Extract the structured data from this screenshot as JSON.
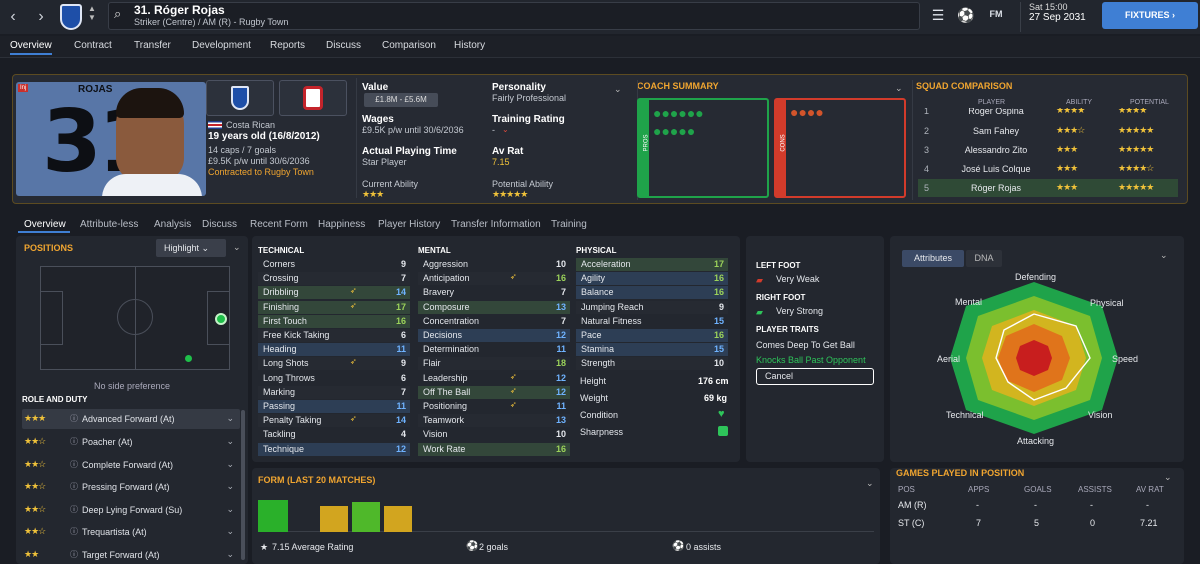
{
  "header": {
    "title": "31. Róger Rojas",
    "subtitle": "Striker (Centre) / AM (R) - Rugby Town",
    "date_day": "Sat 15:00",
    "date": "27 Sep 2031",
    "fixtures": "FIXTURES",
    "fm": "FM"
  },
  "menu": [
    "Overview",
    "Contract",
    "Transfer",
    "Development",
    "Reports",
    "Discuss",
    "Comparison",
    "History"
  ],
  "profile": {
    "inj": "Inj",
    "shirt_name": "ROJAS",
    "shirt_number": "31",
    "nationality": "Costa Rican",
    "age": "19 years old (16/8/2012)",
    "caps": "14 caps / 7 goals",
    "wage_line": "£9.5K p/w until 30/6/2036",
    "contract": "Contracted to Rugby Town"
  },
  "info": {
    "value_label": "Value",
    "value": "£1.8M - £5.6M",
    "personality_label": "Personality",
    "personality": "Fairly Professional",
    "wages_label": "Wages",
    "wages": "£9.5K p/w until 30/6/2036",
    "training_label": "Training Rating",
    "training": "-",
    "apt_label": "Actual Playing Time",
    "apt": "Star Player",
    "avrat_label": "Av Rat",
    "avrat": "7.15",
    "ca_label": "Current Ability",
    "pa_label": "Potential Ability",
    "ca_stars": "★★★",
    "pa_stars": "★★★★★"
  },
  "coach": {
    "title": "COACH SUMMARY",
    "pros": "PROS",
    "cons": "CONS"
  },
  "squad": {
    "title": "SQUAD COMPARISON",
    "col_player": "PLAYER",
    "col_ability": "ABILITY",
    "col_potential": "POTENTIAL",
    "rows": [
      {
        "num": "1",
        "name": "Roger Ospina",
        "ab": "★★★★",
        "po": "★★★★"
      },
      {
        "num": "2",
        "name": "Sam Fahey",
        "ab": "★★★☆",
        "po": "★★★★★"
      },
      {
        "num": "3",
        "name": "Alessandro Zito",
        "ab": "★★★",
        "po": "★★★★★"
      },
      {
        "num": "4",
        "name": "José Luis Colque",
        "ab": "★★★",
        "po": "★★★★☆"
      },
      {
        "num": "5",
        "name": "Róger Rojas",
        "ab": "★★★",
        "po": "★★★★★"
      }
    ]
  },
  "tabs": [
    "Overview",
    "Attribute-less",
    "Analysis",
    "Discuss",
    "Recent Form",
    "Happiness",
    "Player History",
    "Transfer Information",
    "Training"
  ],
  "positions": {
    "title": "POSITIONS",
    "highlight": "Highlight",
    "no_side": "No side preference",
    "role_title": "ROLE AND DUTY"
  },
  "roles": [
    {
      "stars": "★★★",
      "name": "Advanced Forward (At)"
    },
    {
      "stars": "★★☆",
      "name": "Poacher (At)"
    },
    {
      "stars": "★★☆",
      "name": "Complete Forward (At)"
    },
    {
      "stars": "★★☆",
      "name": "Pressing Forward (At)"
    },
    {
      "stars": "★★☆",
      "name": "Deep Lying Forward (Su)"
    },
    {
      "stars": "★★☆",
      "name": "Trequartista (At)"
    },
    {
      "stars": "★★",
      "name": "Target Forward (At)"
    }
  ],
  "technical": {
    "title": "TECHNICAL",
    "rows": [
      [
        "Corners",
        "9"
      ],
      [
        "Crossing",
        "7"
      ],
      [
        "Dribbling",
        "14"
      ],
      [
        "Finishing",
        "17"
      ],
      [
        "First Touch",
        "16"
      ],
      [
        "Free Kick Taking",
        "6"
      ],
      [
        "Heading",
        "11"
      ],
      [
        "Long Shots",
        "9"
      ],
      [
        "Long Throws",
        "6"
      ],
      [
        "Marking",
        "7"
      ],
      [
        "Passing",
        "11"
      ],
      [
        "Penalty Taking",
        "14"
      ],
      [
        "Tackling",
        "4"
      ],
      [
        "Technique",
        "12"
      ]
    ]
  },
  "mental": {
    "title": "MENTAL",
    "rows": [
      [
        "Aggression",
        "10"
      ],
      [
        "Anticipation",
        "16"
      ],
      [
        "Bravery",
        "7"
      ],
      [
        "Composure",
        "13"
      ],
      [
        "Concentration",
        "7"
      ],
      [
        "Decisions",
        "12"
      ],
      [
        "Determination",
        "11"
      ],
      [
        "Flair",
        "18"
      ],
      [
        "Leadership",
        "12"
      ],
      [
        "Off The Ball",
        "12"
      ],
      [
        "Positioning",
        "11"
      ],
      [
        "Teamwork",
        "13"
      ],
      [
        "Vision",
        "10"
      ],
      [
        "Work Rate",
        "16"
      ]
    ]
  },
  "physical": {
    "title": "PHYSICAL",
    "rows": [
      [
        "Acceleration",
        "17"
      ],
      [
        "Agility",
        "16"
      ],
      [
        "Balance",
        "16"
      ],
      [
        "Jumping Reach",
        "9"
      ],
      [
        "Natural Fitness",
        "15"
      ],
      [
        "Pace",
        "16"
      ],
      [
        "Stamina",
        "15"
      ],
      [
        "Strength",
        "10"
      ]
    ],
    "height_label": "Height",
    "height": "176 cm",
    "weight_label": "Weight",
    "weight": "69 kg",
    "condition_label": "Condition",
    "sharpness_label": "Sharpness"
  },
  "feet": {
    "left_label": "LEFT FOOT",
    "left": "Very Weak",
    "right_label": "RIGHT FOOT",
    "right": "Very Strong",
    "traits_label": "PLAYER TRAITS",
    "trait1": "Comes Deep To Get Ball",
    "trait2": "Knocks Ball Past Opponent",
    "cancel": "Cancel"
  },
  "radar": {
    "tab1": "Attributes",
    "tab2": "DNA",
    "labels": [
      "Defending",
      "Physical",
      "Speed",
      "Vision",
      "Attacking",
      "Technical",
      "Aerial",
      "Mental"
    ]
  },
  "form": {
    "title": "FORM (LAST 20 MATCHES)",
    "avg": "7.15 Average Rating",
    "goals": "2 goals",
    "assists": "0 assists"
  },
  "games": {
    "title": "GAMES PLAYED IN POSITION",
    "cols": [
      "POS",
      "APPS",
      "GOALS",
      "ASSISTS",
      "AV RAT"
    ],
    "rows": [
      [
        "AM (R)",
        "-",
        "-",
        "-",
        "-"
      ],
      [
        "ST (C)",
        "7",
        "5",
        "0",
        "7.21"
      ]
    ]
  },
  "colors": {
    "accent": "#f0a530",
    "blue": "#3f7fd4",
    "green": "#1fa34a",
    "red": "#d23b2b"
  }
}
